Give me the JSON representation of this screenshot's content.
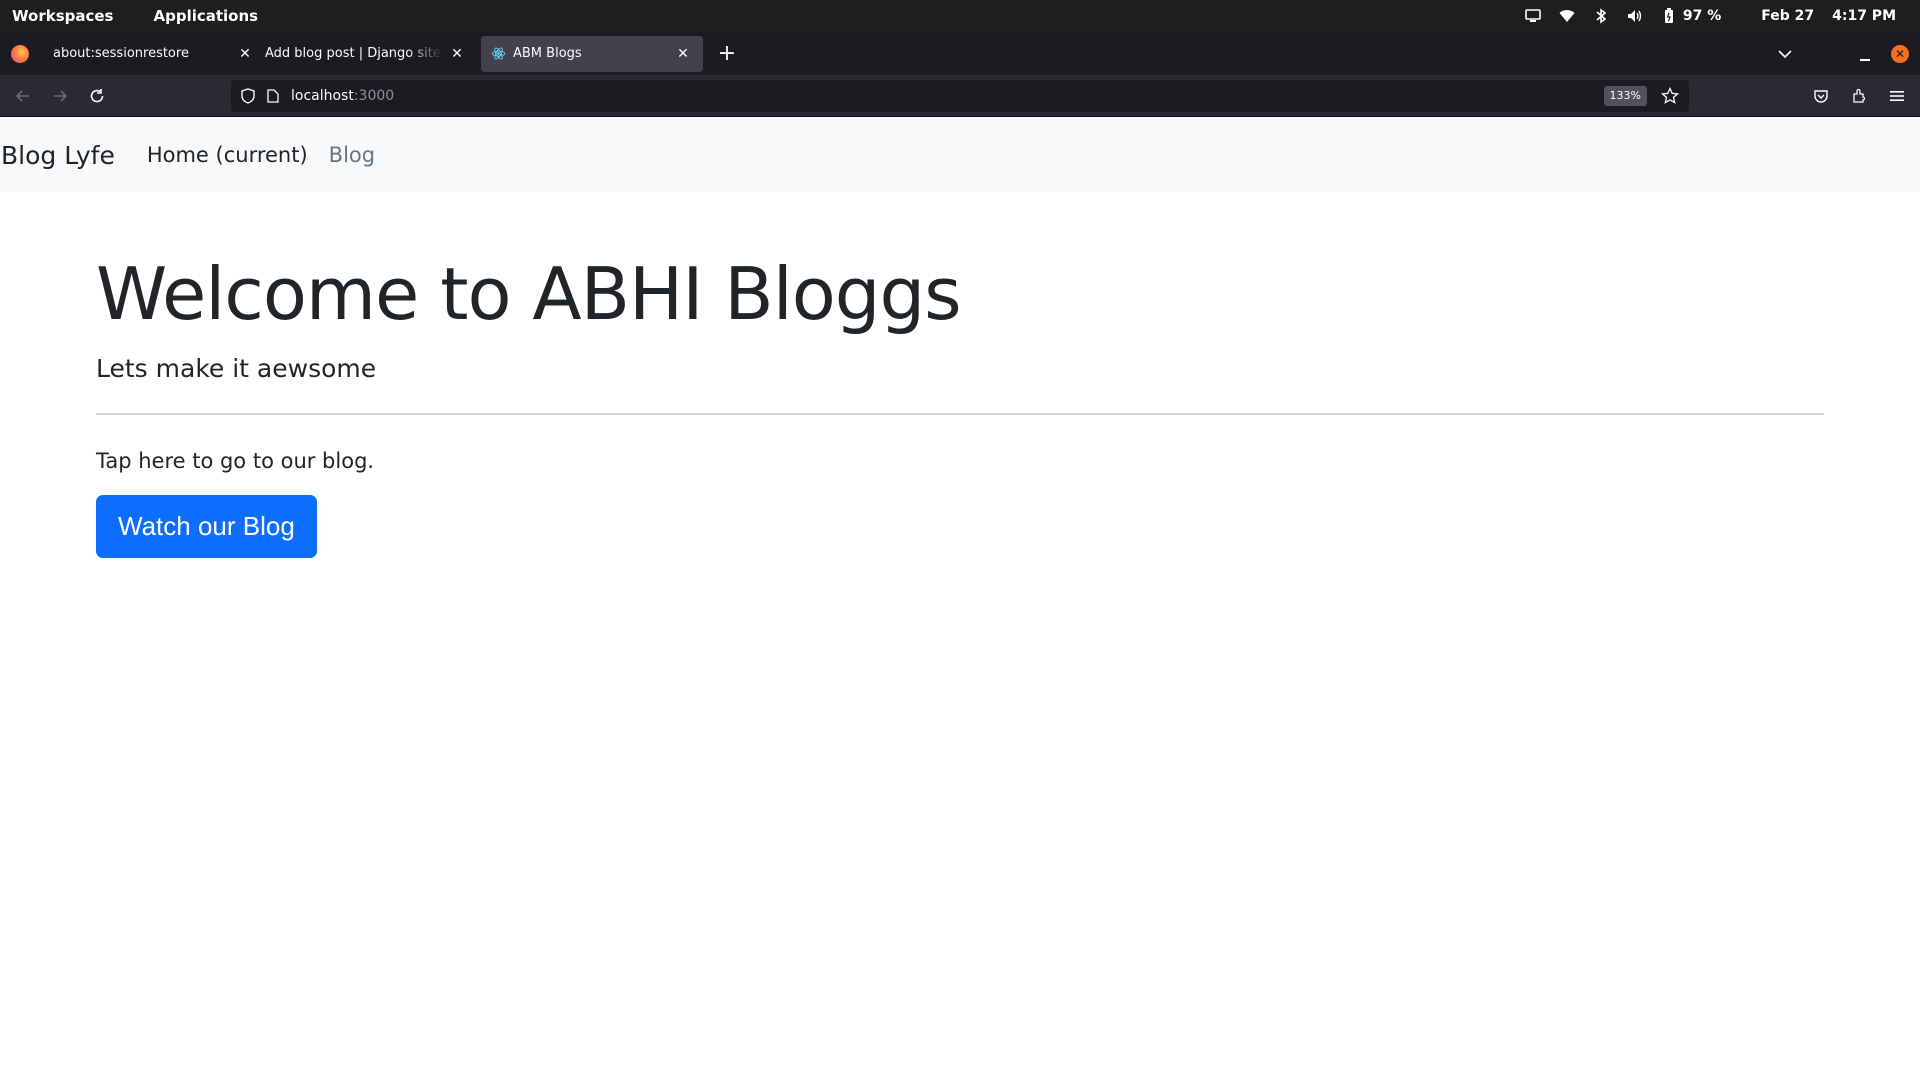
{
  "system_bar": {
    "menus": [
      "Workspaces",
      "Applications"
    ],
    "battery": "97 %",
    "date": "Feb 27",
    "time": "4:17 PM"
  },
  "browser": {
    "tabs": [
      {
        "label": "about:sessionrestore",
        "active": false
      },
      {
        "label": "Add blog post | Django site admin",
        "active": false
      },
      {
        "label": "ABM Blogs",
        "active": true
      }
    ],
    "url_host": "localhost",
    "url_rest": ":3000",
    "zoom": "133%"
  },
  "site": {
    "brand": "Blog Lyfe",
    "nav": [
      {
        "label": "Home (current)",
        "current": true
      },
      {
        "label": "Blog",
        "current": false
      }
    ],
    "heading": "Welcome to ABHI Bloggs",
    "lead": "Lets make it aewsome",
    "paragraph": "Tap here to go to our blog.",
    "button": "Watch our Blog"
  },
  "colors": {
    "primary": "#0d6efd",
    "navbar_bg": "#f8f9fa",
    "text": "#212529",
    "muted": "#6c757d"
  }
}
